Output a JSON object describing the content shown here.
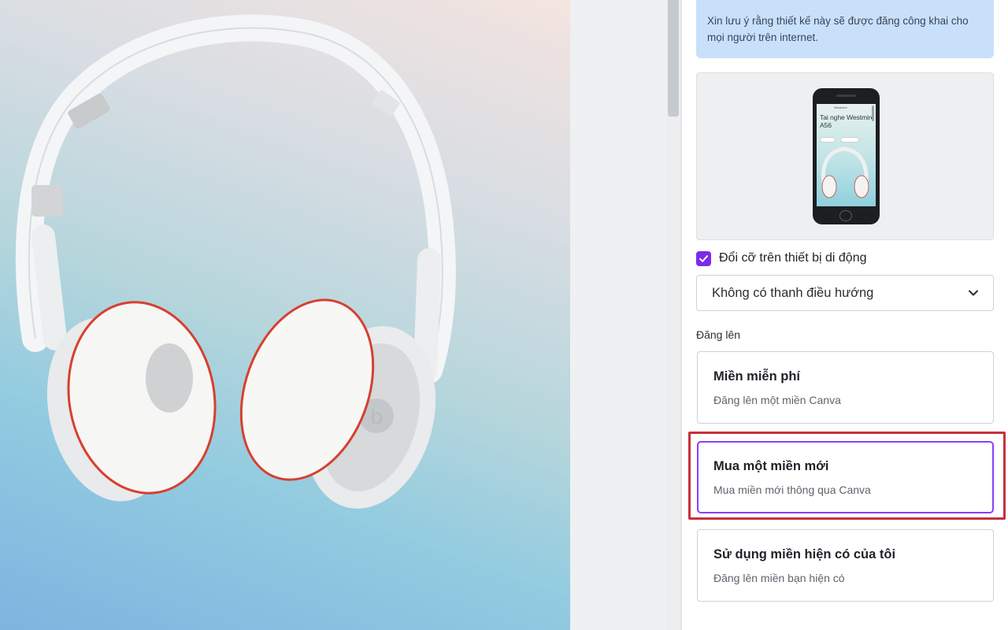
{
  "info_notice": "Xin lưu ý rằng thiết kế này sẽ được đăng công khai cho mọi người trên internet.",
  "preview": {
    "brand": "Westmire",
    "title": "Tai nghe Westmire A56"
  },
  "mobile_resize": {
    "label": "Đổi cỡ trên thiết bị di động",
    "checked": true
  },
  "navigation_select": {
    "value": "Không có thanh điều hướng"
  },
  "publish_section": {
    "label": "Đăng lên",
    "options": [
      {
        "title": "Miền miễn phí",
        "subtitle": "Đăng lên một miền Canva"
      },
      {
        "title": "Mua một miền mới",
        "subtitle": "Mua miền mới thông qua Canva"
      },
      {
        "title": "Sử dụng miền hiện có của tôi",
        "subtitle": "Đăng lên miền bạn hiện có"
      }
    ]
  },
  "colors": {
    "accent": "#7d2ae8",
    "selected_border": "#8b3dff",
    "highlight": "#c7303a",
    "info_bg": "#c9e0fb"
  },
  "icons": [
    "headphones-image",
    "check-icon",
    "chevron-down-icon"
  ]
}
